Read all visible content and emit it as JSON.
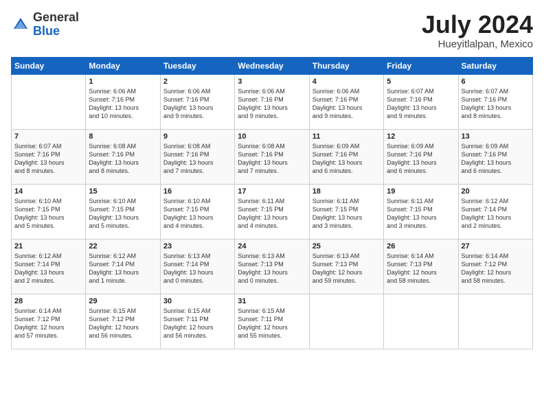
{
  "header": {
    "logo_general": "General",
    "logo_blue": "Blue",
    "month_title": "July 2024",
    "location": "Hueyitlalpan, Mexico"
  },
  "days_of_week": [
    "Sunday",
    "Monday",
    "Tuesday",
    "Wednesday",
    "Thursday",
    "Friday",
    "Saturday"
  ],
  "weeks": [
    [
      {
        "day": "",
        "info": ""
      },
      {
        "day": "1",
        "info": "Sunrise: 6:06 AM\nSunset: 7:16 PM\nDaylight: 13 hours\nand 10 minutes."
      },
      {
        "day": "2",
        "info": "Sunrise: 6:06 AM\nSunset: 7:16 PM\nDaylight: 13 hours\nand 9 minutes."
      },
      {
        "day": "3",
        "info": "Sunrise: 6:06 AM\nSunset: 7:16 PM\nDaylight: 13 hours\nand 9 minutes."
      },
      {
        "day": "4",
        "info": "Sunrise: 6:06 AM\nSunset: 7:16 PM\nDaylight: 13 hours\nand 9 minutes."
      },
      {
        "day": "5",
        "info": "Sunrise: 6:07 AM\nSunset: 7:16 PM\nDaylight: 13 hours\nand 9 minutes."
      },
      {
        "day": "6",
        "info": "Sunrise: 6:07 AM\nSunset: 7:16 PM\nDaylight: 13 hours\nand 8 minutes."
      }
    ],
    [
      {
        "day": "7",
        "info": "Sunrise: 6:07 AM\nSunset: 7:16 PM\nDaylight: 13 hours\nand 8 minutes."
      },
      {
        "day": "8",
        "info": "Sunrise: 6:08 AM\nSunset: 7:16 PM\nDaylight: 13 hours\nand 8 minutes."
      },
      {
        "day": "9",
        "info": "Sunrise: 6:08 AM\nSunset: 7:16 PM\nDaylight: 13 hours\nand 7 minutes."
      },
      {
        "day": "10",
        "info": "Sunrise: 6:08 AM\nSunset: 7:16 PM\nDaylight: 13 hours\nand 7 minutes."
      },
      {
        "day": "11",
        "info": "Sunrise: 6:09 AM\nSunset: 7:16 PM\nDaylight: 13 hours\nand 6 minutes."
      },
      {
        "day": "12",
        "info": "Sunrise: 6:09 AM\nSunset: 7:16 PM\nDaylight: 13 hours\nand 6 minutes."
      },
      {
        "day": "13",
        "info": "Sunrise: 6:09 AM\nSunset: 7:16 PM\nDaylight: 13 hours\nand 6 minutes."
      }
    ],
    [
      {
        "day": "14",
        "info": "Sunrise: 6:10 AM\nSunset: 7:15 PM\nDaylight: 13 hours\nand 5 minutes."
      },
      {
        "day": "15",
        "info": "Sunrise: 6:10 AM\nSunset: 7:15 PM\nDaylight: 13 hours\nand 5 minutes."
      },
      {
        "day": "16",
        "info": "Sunrise: 6:10 AM\nSunset: 7:15 PM\nDaylight: 13 hours\nand 4 minutes."
      },
      {
        "day": "17",
        "info": "Sunrise: 6:11 AM\nSunset: 7:15 PM\nDaylight: 13 hours\nand 4 minutes."
      },
      {
        "day": "18",
        "info": "Sunrise: 6:11 AM\nSunset: 7:15 PM\nDaylight: 13 hours\nand 3 minutes."
      },
      {
        "day": "19",
        "info": "Sunrise: 6:11 AM\nSunset: 7:15 PM\nDaylight: 13 hours\nand 3 minutes."
      },
      {
        "day": "20",
        "info": "Sunrise: 6:12 AM\nSunset: 7:14 PM\nDaylight: 13 hours\nand 2 minutes."
      }
    ],
    [
      {
        "day": "21",
        "info": "Sunrise: 6:12 AM\nSunset: 7:14 PM\nDaylight: 13 hours\nand 2 minutes."
      },
      {
        "day": "22",
        "info": "Sunrise: 6:12 AM\nSunset: 7:14 PM\nDaylight: 13 hours\nand 1 minute."
      },
      {
        "day": "23",
        "info": "Sunrise: 6:13 AM\nSunset: 7:14 PM\nDaylight: 13 hours\nand 0 minutes."
      },
      {
        "day": "24",
        "info": "Sunrise: 6:13 AM\nSunset: 7:13 PM\nDaylight: 13 hours\nand 0 minutes."
      },
      {
        "day": "25",
        "info": "Sunrise: 6:13 AM\nSunset: 7:13 PM\nDaylight: 12 hours\nand 59 minutes."
      },
      {
        "day": "26",
        "info": "Sunrise: 6:14 AM\nSunset: 7:13 PM\nDaylight: 12 hours\nand 58 minutes."
      },
      {
        "day": "27",
        "info": "Sunrise: 6:14 AM\nSunset: 7:12 PM\nDaylight: 12 hours\nand 58 minutes."
      }
    ],
    [
      {
        "day": "28",
        "info": "Sunrise: 6:14 AM\nSunset: 7:12 PM\nDaylight: 12 hours\nand 57 minutes."
      },
      {
        "day": "29",
        "info": "Sunrise: 6:15 AM\nSunset: 7:12 PM\nDaylight: 12 hours\nand 56 minutes."
      },
      {
        "day": "30",
        "info": "Sunrise: 6:15 AM\nSunset: 7:11 PM\nDaylight: 12 hours\nand 56 minutes."
      },
      {
        "day": "31",
        "info": "Sunrise: 6:15 AM\nSunset: 7:11 PM\nDaylight: 12 hours\nand 55 minutes."
      },
      {
        "day": "",
        "info": ""
      },
      {
        "day": "",
        "info": ""
      },
      {
        "day": "",
        "info": ""
      }
    ]
  ]
}
